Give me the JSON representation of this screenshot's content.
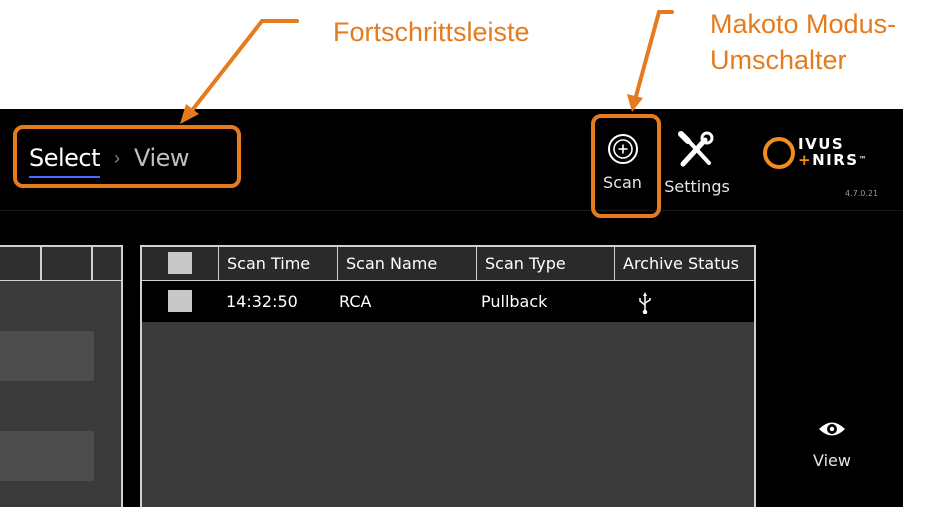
{
  "annotations": {
    "progress_bar_label": "Fortschrittsleiste",
    "mode_switch_label_line1": "Makoto Modus-",
    "mode_switch_label_line2": "Umschalter",
    "callout_color": "#e57b1c"
  },
  "breadcrumb": {
    "steps": [
      "Select",
      "View"
    ],
    "active_index": 0,
    "separator": "›"
  },
  "toolbar": {
    "scan_label": "Scan",
    "scan_icon": "scan-plus-icon",
    "settings_label": "Settings",
    "settings_icon": "wrench-screwdriver-icon"
  },
  "logo": {
    "line1": "IVUS",
    "line2_plus": "+",
    "line2": "NIRS",
    "tm": "™",
    "version": "4.7.0.21"
  },
  "scan_table": {
    "columns": [
      "",
      "Scan Time",
      "Scan Name",
      "Scan Type",
      "Archive Status"
    ],
    "rows": [
      {
        "checked": false,
        "scan_time": "14:32:50",
        "scan_name": "RCA",
        "scan_type": "Pullback",
        "archive_status_icon": "usb-icon",
        "archive_status": "ψ"
      }
    ]
  },
  "view_button": {
    "label": "View",
    "icon": "eye-icon"
  },
  "colors": {
    "background": "#000000",
    "panel": "#3b3b3b",
    "accent_orange": "#e57b1c",
    "active_underline": "#4a6cff"
  }
}
